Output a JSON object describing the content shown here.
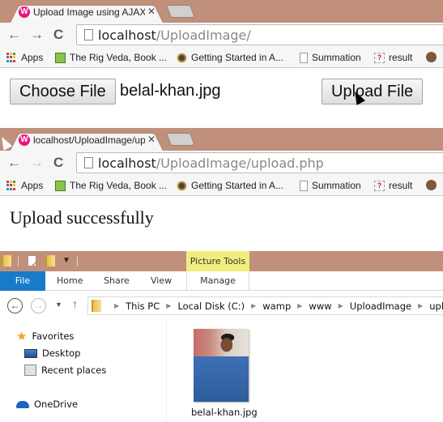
{
  "browser_window_1": {
    "tab_title": "Upload Image using AJAX",
    "favicon": "wamp-icon",
    "url_host": "localhost",
    "url_path": "/UploadImage/",
    "nav": {
      "back": "←",
      "forward": "→",
      "reload": "C"
    },
    "bookmarks": [
      {
        "label": "Apps",
        "icon": "apps-grid-icon"
      },
      {
        "label": "The Rig Veda, Book ...",
        "icon": "rig-veda-icon"
      },
      {
        "label": "Getting Started in A...",
        "icon": "getting-started-icon"
      },
      {
        "label": "Summation",
        "icon": "page-icon"
      },
      {
        "label": "result",
        "icon": "unknown-page-icon"
      },
      {
        "label": "",
        "icon": "cookie-icon"
      }
    ],
    "page": {
      "choose_file_label": "Choose File",
      "selected_file": "belal-khan.jpg",
      "upload_button_label": "Upload File"
    }
  },
  "browser_window_2": {
    "tab_title": "localhost/UploadImage/upload.php",
    "favicon": "wamp-icon",
    "url_host": "localhost",
    "url_path": "/UploadImage/upload.php",
    "nav": {
      "back": "←",
      "forward": "→",
      "reload": "C"
    },
    "bookmarks": [
      {
        "label": "Apps",
        "icon": "apps-grid-icon"
      },
      {
        "label": "The Rig Veda, Book ...",
        "icon": "rig-veda-icon"
      },
      {
        "label": "Getting Started in A...",
        "icon": "getting-started-icon"
      },
      {
        "label": "Summation",
        "icon": "page-icon"
      },
      {
        "label": "result",
        "icon": "unknown-page-icon"
      },
      {
        "label": "",
        "icon": "cookie-icon"
      }
    ],
    "page": {
      "message": "Upload successfully"
    }
  },
  "explorer": {
    "contextual_tab_group": "Picture Tools",
    "ribbon_tabs": [
      "File",
      "Home",
      "Share",
      "View",
      "Manage"
    ],
    "breadcrumbs": [
      "This PC",
      "Local Disk (C:)",
      "wamp",
      "www",
      "UploadImage",
      "uploads"
    ],
    "nav_pane": {
      "favorites_label": "Favorites",
      "favorites": [
        "Desktop",
        "Recent places"
      ],
      "onedrive_label": "OneDrive"
    },
    "files": [
      {
        "name": "belal-khan.jpg",
        "type": "image"
      }
    ],
    "colors": {
      "titlebar": "#c0907b",
      "file_tab": "#1979ca",
      "picture_tools": "#f0ee7e"
    }
  }
}
